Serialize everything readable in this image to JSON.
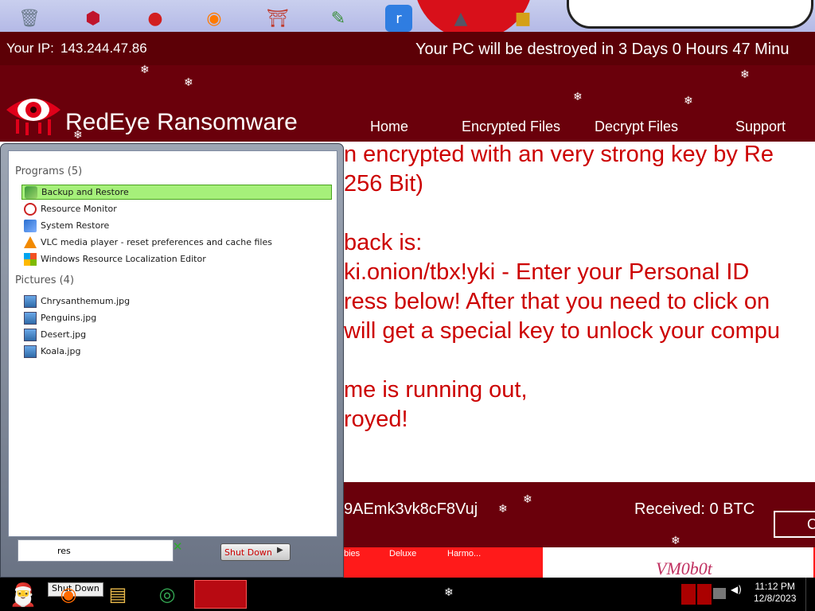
{
  "ransom_window": {
    "ip_label": "Your IP:",
    "ip_value": "143.244.47.86",
    "countdown": "Your PC will be destroyed in 3 Days 0 Hours 47 Minu",
    "app_name": "RedEye Ransomware",
    "nav": [
      "Home",
      "Encrypted Files",
      "Decrypt Files",
      "Support"
    ],
    "message_lines": [
      "n encrypted with an very strong key by Re",
      " 256 Bit)",
      "back is:",
      "ki.onion/tbx!yki - Enter your Personal ID",
      "ress below! After that you need to click on",
      "will get a special key to unlock your compu",
      "me is running out,",
      "royed!"
    ],
    "btc_address_partial": "9AEmk3vk8cF8Vuj",
    "received": "Received: 0 BTC",
    "check_button": "C",
    "colors": {
      "bar": "#5c0006",
      "header": "#6a000b",
      "text": "#cc0000"
    }
  },
  "start_menu": {
    "groups": [
      {
        "title": "Programs (5)",
        "items": [
          {
            "label": "Backup and Restore",
            "icon": "backup-restore-icon",
            "selected": true
          },
          {
            "label": "Resource Monitor",
            "icon": "resource-monitor-icon",
            "selected": false
          },
          {
            "label": "System Restore",
            "icon": "system-restore-icon",
            "selected": false
          },
          {
            "label": "VLC media player - reset preferences and cache files",
            "icon": "vlc-icon",
            "selected": false
          },
          {
            "label": "Windows Resource Localization Editor",
            "icon": "windows-logo-icon",
            "selected": false
          }
        ]
      },
      {
        "title": "Pictures (4)",
        "items": [
          {
            "label": "Chrysanthemum.jpg",
            "icon": "picture-file-icon"
          },
          {
            "label": "Penguins.jpg",
            "icon": "picture-file-icon"
          },
          {
            "label": "Desert.jpg",
            "icon": "picture-file-icon"
          },
          {
            "label": "Koala.jpg",
            "icon": "picture-file-icon"
          }
        ]
      }
    ],
    "search_value": "res",
    "shutdown_label": "Shut Down"
  },
  "desktop_bottom": {
    "labels": [
      "bies",
      "Deluxe",
      "Harmo..."
    ],
    "poster_text": "VM0b0t"
  },
  "taskbar": {
    "shutdown_label": "Shut Down",
    "time": "11:12 PM",
    "date": "12/8/2023"
  }
}
